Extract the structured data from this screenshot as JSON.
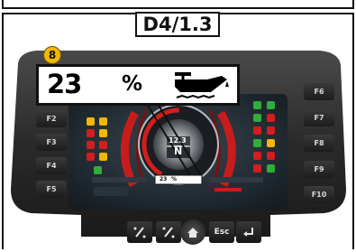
{
  "header": {
    "title": "D4/1.3"
  },
  "callout": {
    "number": "8",
    "percent_value": "23",
    "percent_unit": "%",
    "icon": "oil-can-level-icon"
  },
  "left_keys": [
    {
      "label": "F2"
    },
    {
      "label": "F3"
    },
    {
      "label": "F4"
    },
    {
      "label": "F5"
    }
  ],
  "right_keys": [
    {
      "label": "F6"
    },
    {
      "label": "F7"
    },
    {
      "label": "F8"
    },
    {
      "label": "F9"
    },
    {
      "label": "F10"
    }
  ],
  "bottom_keys": [
    {
      "label": "",
      "icon": "slash-modify-icon"
    },
    {
      "label": "",
      "icon": "slash-modify-icon"
    },
    {
      "label": "",
      "icon": "home-icon"
    },
    {
      "label": "Esc",
      "icon": ""
    },
    {
      "label": "",
      "icon": "enter-icon"
    }
  ],
  "gauge": {
    "center_value": "12.3",
    "gear": "N"
  },
  "status_strip": {
    "percent_value": "23",
    "percent_unit": "%"
  },
  "colors": {
    "accent": "#f2b705",
    "bezel": "#2b2b2b",
    "screen": "#1f2a33"
  }
}
